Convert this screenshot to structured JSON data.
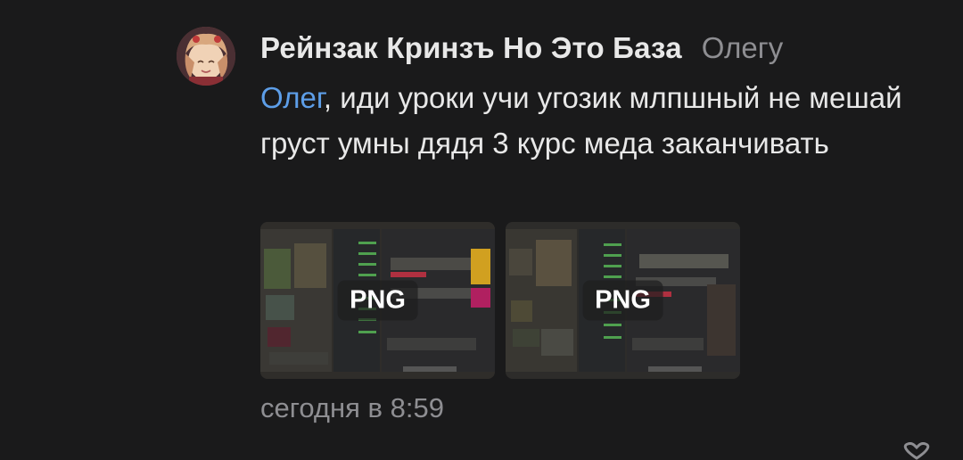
{
  "comment": {
    "author": "Рейнзак Кринзъ Но Это База",
    "reply_to": "Олегу",
    "mention": "Олег",
    "text": ", иди уроки учи угозик млпшный не мешай груст умны дядя 3 курс меда заканчивать",
    "attachments": [
      {
        "label": "PNG"
      },
      {
        "label": "PNG"
      }
    ],
    "timestamp": "сегодня в 8:59"
  },
  "colors": {
    "background": "#1a1a1b",
    "text": "#e8e8e8",
    "muted": "#8e8e92",
    "mention": "#5d9ee8"
  },
  "icons": {
    "avatar": "avatar-anime-girl",
    "like": "heart-icon"
  }
}
